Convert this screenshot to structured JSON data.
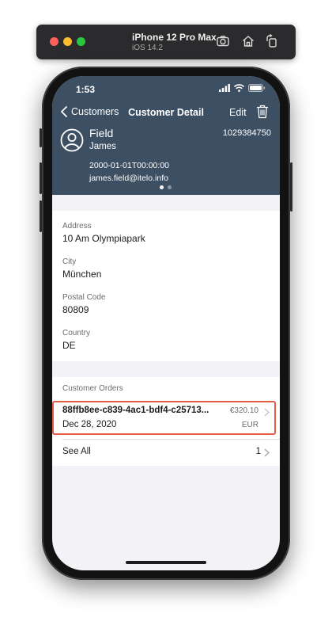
{
  "simulator": {
    "device_name": "iPhone 12 Pro Max",
    "os_version": "iOS 14.2",
    "tools": [
      "screenshot-icon",
      "home-icon",
      "rotate-icon"
    ]
  },
  "status_bar": {
    "time": "1:53"
  },
  "nav": {
    "back_label": "Customers",
    "title": "Customer Detail",
    "edit_label": "Edit"
  },
  "customer": {
    "last_name": "Field",
    "first_name": "James",
    "id": "1029384750",
    "birth_date": "2000-01-01T00:00:00",
    "email": "james.field@itelo.info"
  },
  "page_indicator": {
    "pages": 2,
    "current": 1
  },
  "address": {
    "address_label": "Address",
    "address_value": "10 Am Olympiapark",
    "city_label": "City",
    "city_value": "München",
    "postal_label": "Postal Code",
    "postal_value": "80809",
    "country_label": "Country",
    "country_value": "DE"
  },
  "orders": {
    "section_title": "Customer Orders",
    "items": [
      {
        "id": "88ffb8ee-c839-4ac1-bdf4-c25713...",
        "date": "Dec 28, 2020",
        "amount": "€320.10",
        "currency": "EUR"
      }
    ],
    "see_all_label": "See All",
    "see_all_count": "1"
  },
  "colors": {
    "header_bg": "#3d4f62",
    "highlight": "#e25b45",
    "screen_bg": "#f2f2f7"
  }
}
